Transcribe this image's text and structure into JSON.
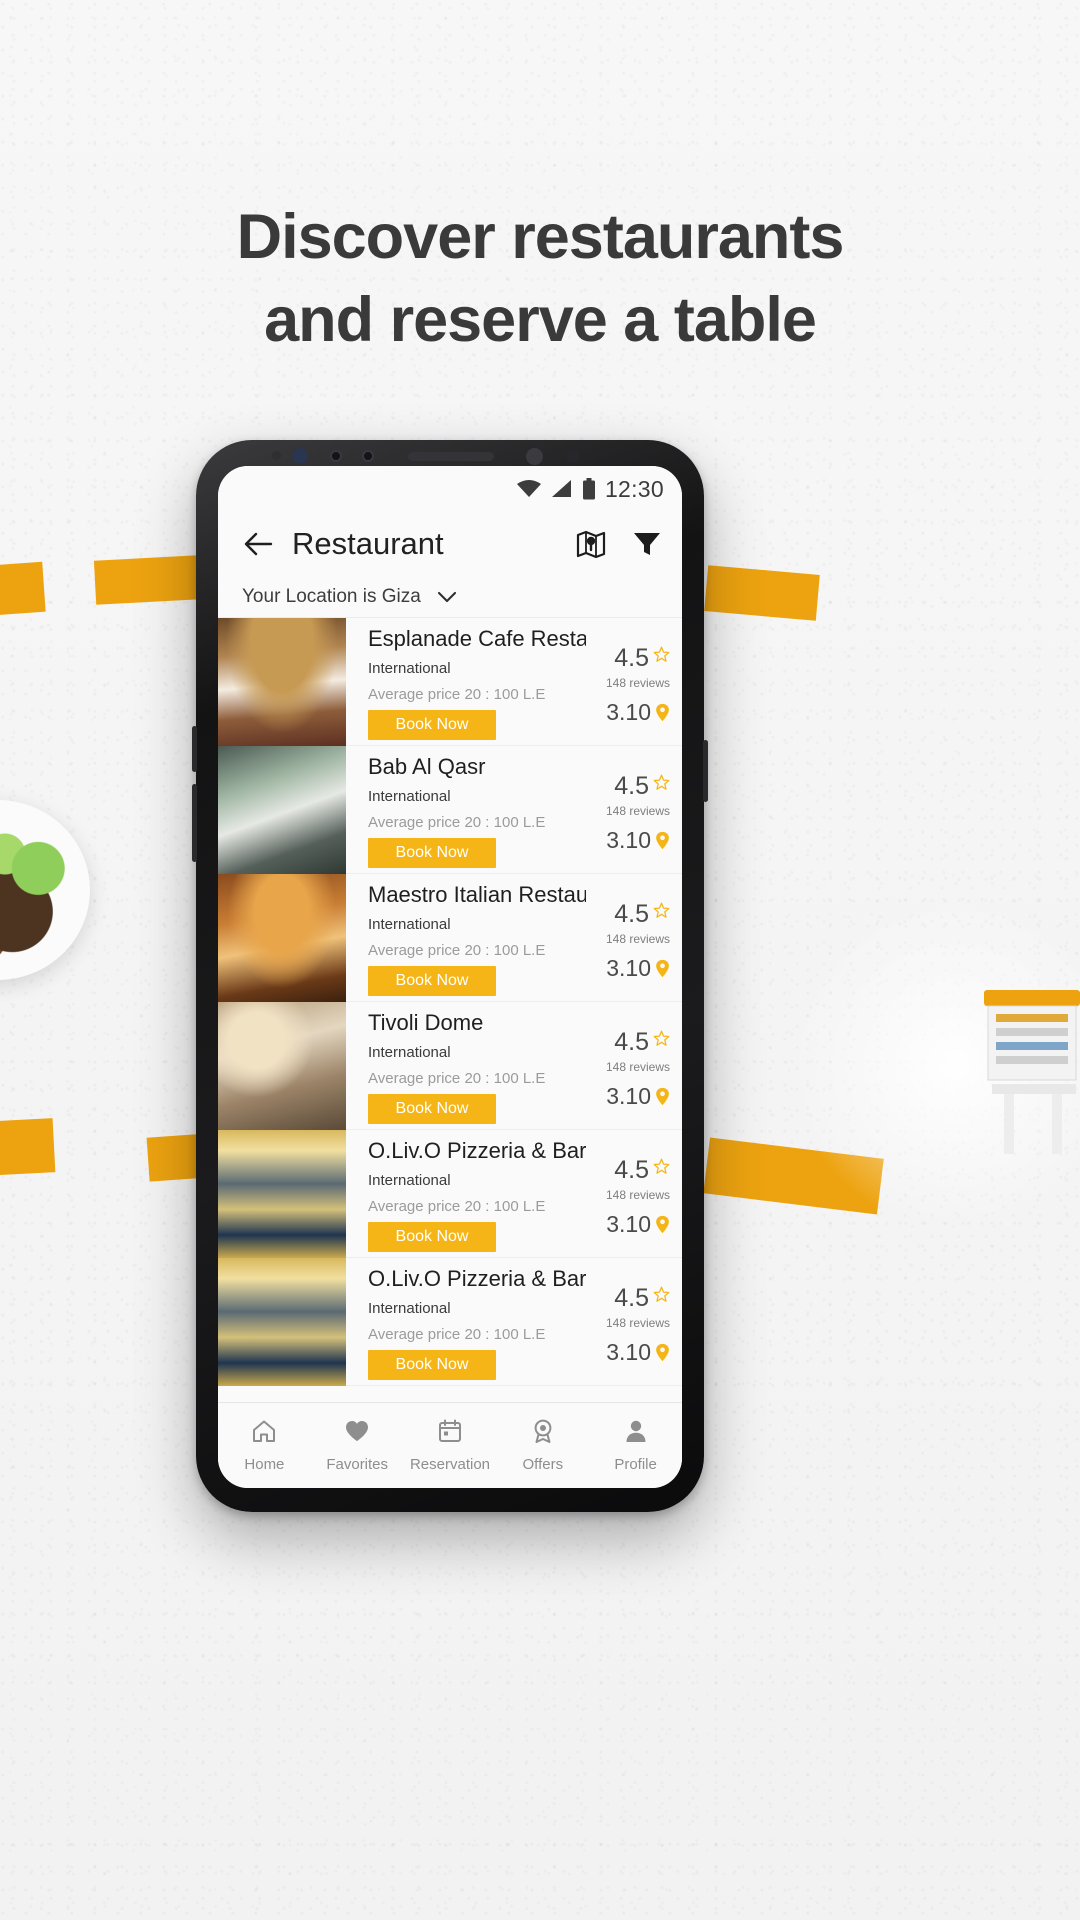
{
  "promo": {
    "headline_line1": "Discover restaurants",
    "headline_line2": "and reserve a table",
    "accent_color": "#eda310",
    "button_color": "#f5b517"
  },
  "status_bar": {
    "time": "12:30",
    "icons": [
      "wifi-icon",
      "cellular-signal-icon",
      "battery-icon"
    ]
  },
  "header": {
    "back_label": "back-arrow-icon",
    "title": "Restaurant",
    "map_icon": "map-pin-icon",
    "filter_icon": "filter-icon"
  },
  "location": {
    "text": "Your Location is Giza",
    "chevron": "chevron-down-icon"
  },
  "restaurants": [
    {
      "name": "Esplanade Cafe Restaurant",
      "cuisine": "International",
      "price": "Average price 20 : 100 L.E",
      "book_label": "Book Now",
      "rating": "4.5",
      "reviews": "148 reviews",
      "distance": "3.10"
    },
    {
      "name": "Bab Al Qasr",
      "cuisine": "International",
      "price": "Average price 20 : 100 L.E",
      "book_label": "Book Now",
      "rating": "4.5",
      "reviews": "148 reviews",
      "distance": "3.10"
    },
    {
      "name": "Maestro Italian Restaurant",
      "cuisine": "International",
      "price": "Average price 20 : 100 L.E",
      "book_label": "Book Now",
      "rating": "4.5",
      "reviews": "148 reviews",
      "distance": "3.10"
    },
    {
      "name": "Tivoli Dome",
      "cuisine": "International",
      "price": "Average price 20 : 100 L.E",
      "book_label": "Book Now",
      "rating": "4.5",
      "reviews": "148 reviews",
      "distance": "3.10"
    },
    {
      "name": "O.Liv.O Pizzeria & Bar",
      "cuisine": "International",
      "price": "Average price 20 : 100 L.E",
      "book_label": "Book Now",
      "rating": "4.5",
      "reviews": "148 reviews",
      "distance": "3.10"
    },
    {
      "name": "O.Liv.O Pizzeria & Bar",
      "cuisine": "International",
      "price": "Average price 20 : 100 L.E",
      "book_label": "Book Now",
      "rating": "4.5",
      "reviews": "148 reviews",
      "distance": "3.10"
    }
  ],
  "bottom_nav": [
    {
      "label": "Home",
      "icon": "home-icon"
    },
    {
      "label": "Favorites",
      "icon": "heart-icon"
    },
    {
      "label": "Reservation",
      "icon": "calendar-icon"
    },
    {
      "label": "Offers",
      "icon": "badge-icon"
    },
    {
      "label": "Profile",
      "icon": "person-icon"
    }
  ]
}
